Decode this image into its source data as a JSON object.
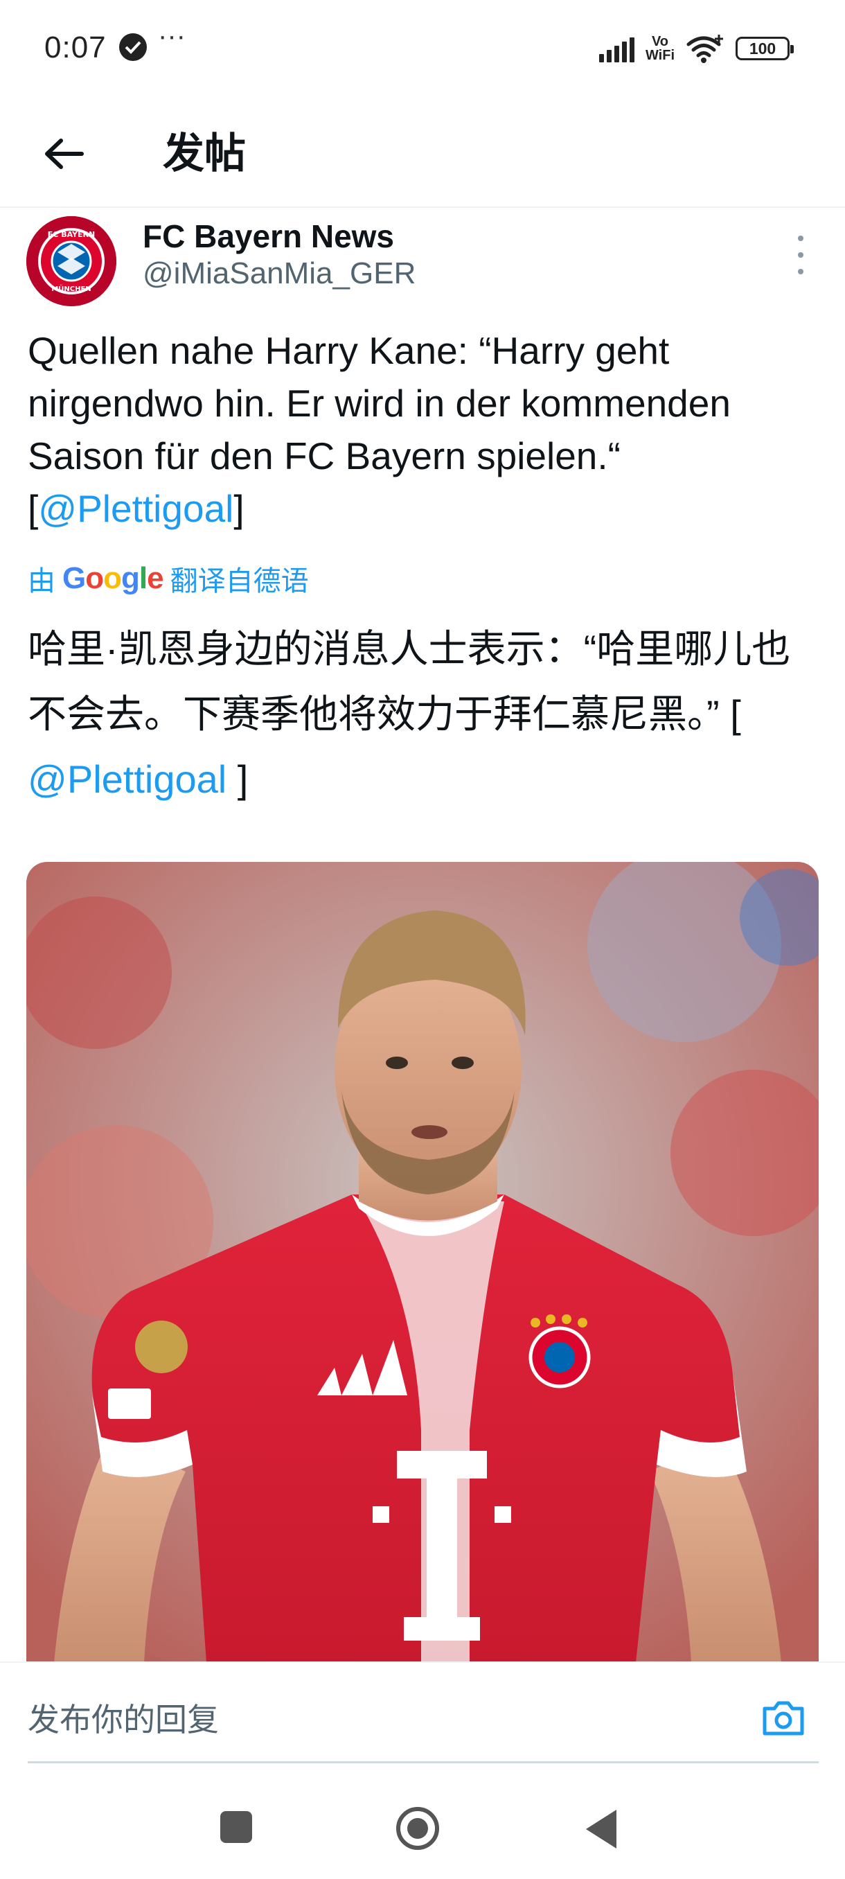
{
  "status_bar": {
    "time": "0:07",
    "dots": "···",
    "network_label": "Vo\nWiFi",
    "battery": "100"
  },
  "header": {
    "title": "发帖"
  },
  "tweet": {
    "author_name": "FC Bayern News",
    "author_handle": "@iMiaSanMia_GER",
    "text_main": "Quellen nahe Harry Kane: “Harry geht nirgendwo hin. Er wird in der kommenden Saison für den FC Bayern spielen.“",
    "text_bracket_open": "[",
    "text_mention": "@Plettigoal",
    "text_bracket_close": "]",
    "translate_prefix": "由",
    "translate_google": "Google",
    "translate_suffix": "翻译自德语",
    "translated_main": "哈里·凯恩身边的消息人士表示：“哈里哪儿也不会去。下赛季他将效力于拜仁慕尼黑。” [ ",
    "translated_mention": "@Plettigoal",
    "translated_close": " ]"
  },
  "reply": {
    "placeholder": "发布你的回复"
  },
  "colors": {
    "link": "#1d9bf0",
    "text": "#0f1419",
    "secondary": "#536471",
    "bayern_red": "#dc052d"
  },
  "icons": {
    "back": "arrow-left-icon",
    "more": "more-vertical-icon",
    "camera": "camera-icon",
    "verified": "check-circle-icon"
  }
}
